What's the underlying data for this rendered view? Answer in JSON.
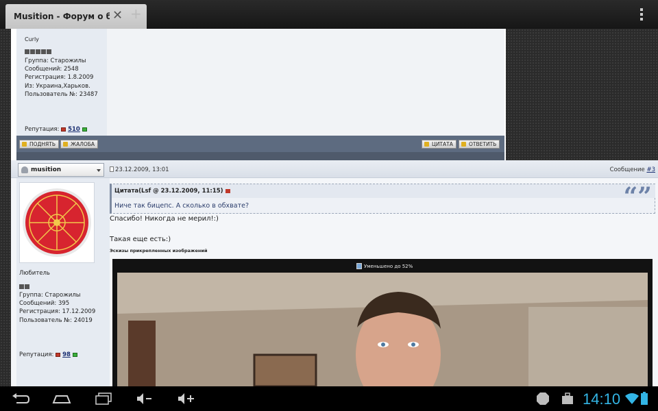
{
  "browser": {
    "tab_title": "Musition - Форум о боди...",
    "new_tab_label": "+",
    "close_label": "✕"
  },
  "prev_post": {
    "username": "Curly",
    "pips": 5,
    "group": "Группа: Старожилы",
    "messages": "Сообщений: 2548",
    "registered": "Регистрация: 1.8.2009",
    "from": "Из: Украина,Харьков.",
    "user_no": "Пользователь №: 23487",
    "reputation_label": "Репутация:",
    "reputation_value": "510",
    "buttons": {
      "up": "ПОДНЯТЬ",
      "report": "ЖАЛОБА",
      "quote": "ЦИТАТА",
      "reply": "ОТВЕТИТЬ"
    }
  },
  "post": {
    "username": "musition",
    "date": "23.12.2009, 13:01",
    "post_label": "Сообщение",
    "post_number": "#3",
    "rank": "Любитель",
    "pips": 2,
    "group": "Группа: Старожилы",
    "messages": "Сообщений: 395",
    "registered": "Регистрация: 17.12.2009",
    "user_no": "Пользователь №: 24019",
    "reputation_label": "Репутация:",
    "reputation_value": "98",
    "quote": {
      "header": "Цитата(Lsf @ 23.12.2009, 11:15)",
      "text": "Ниче так бицепс. А сколько в обхвате?"
    },
    "body_line1": "Спасибо! Никогда не мерил!:)",
    "body_line2": "Такая еще есть:)",
    "thumbs_label": "Эскизы прикрепленных изображений",
    "resize_note": "Уменьшено до 52%"
  },
  "status_bar": {
    "time": "14:10"
  },
  "colors": {
    "accent": "#33b5e5",
    "link": "#1a2f72",
    "quote_text": "#2b3d6b"
  }
}
